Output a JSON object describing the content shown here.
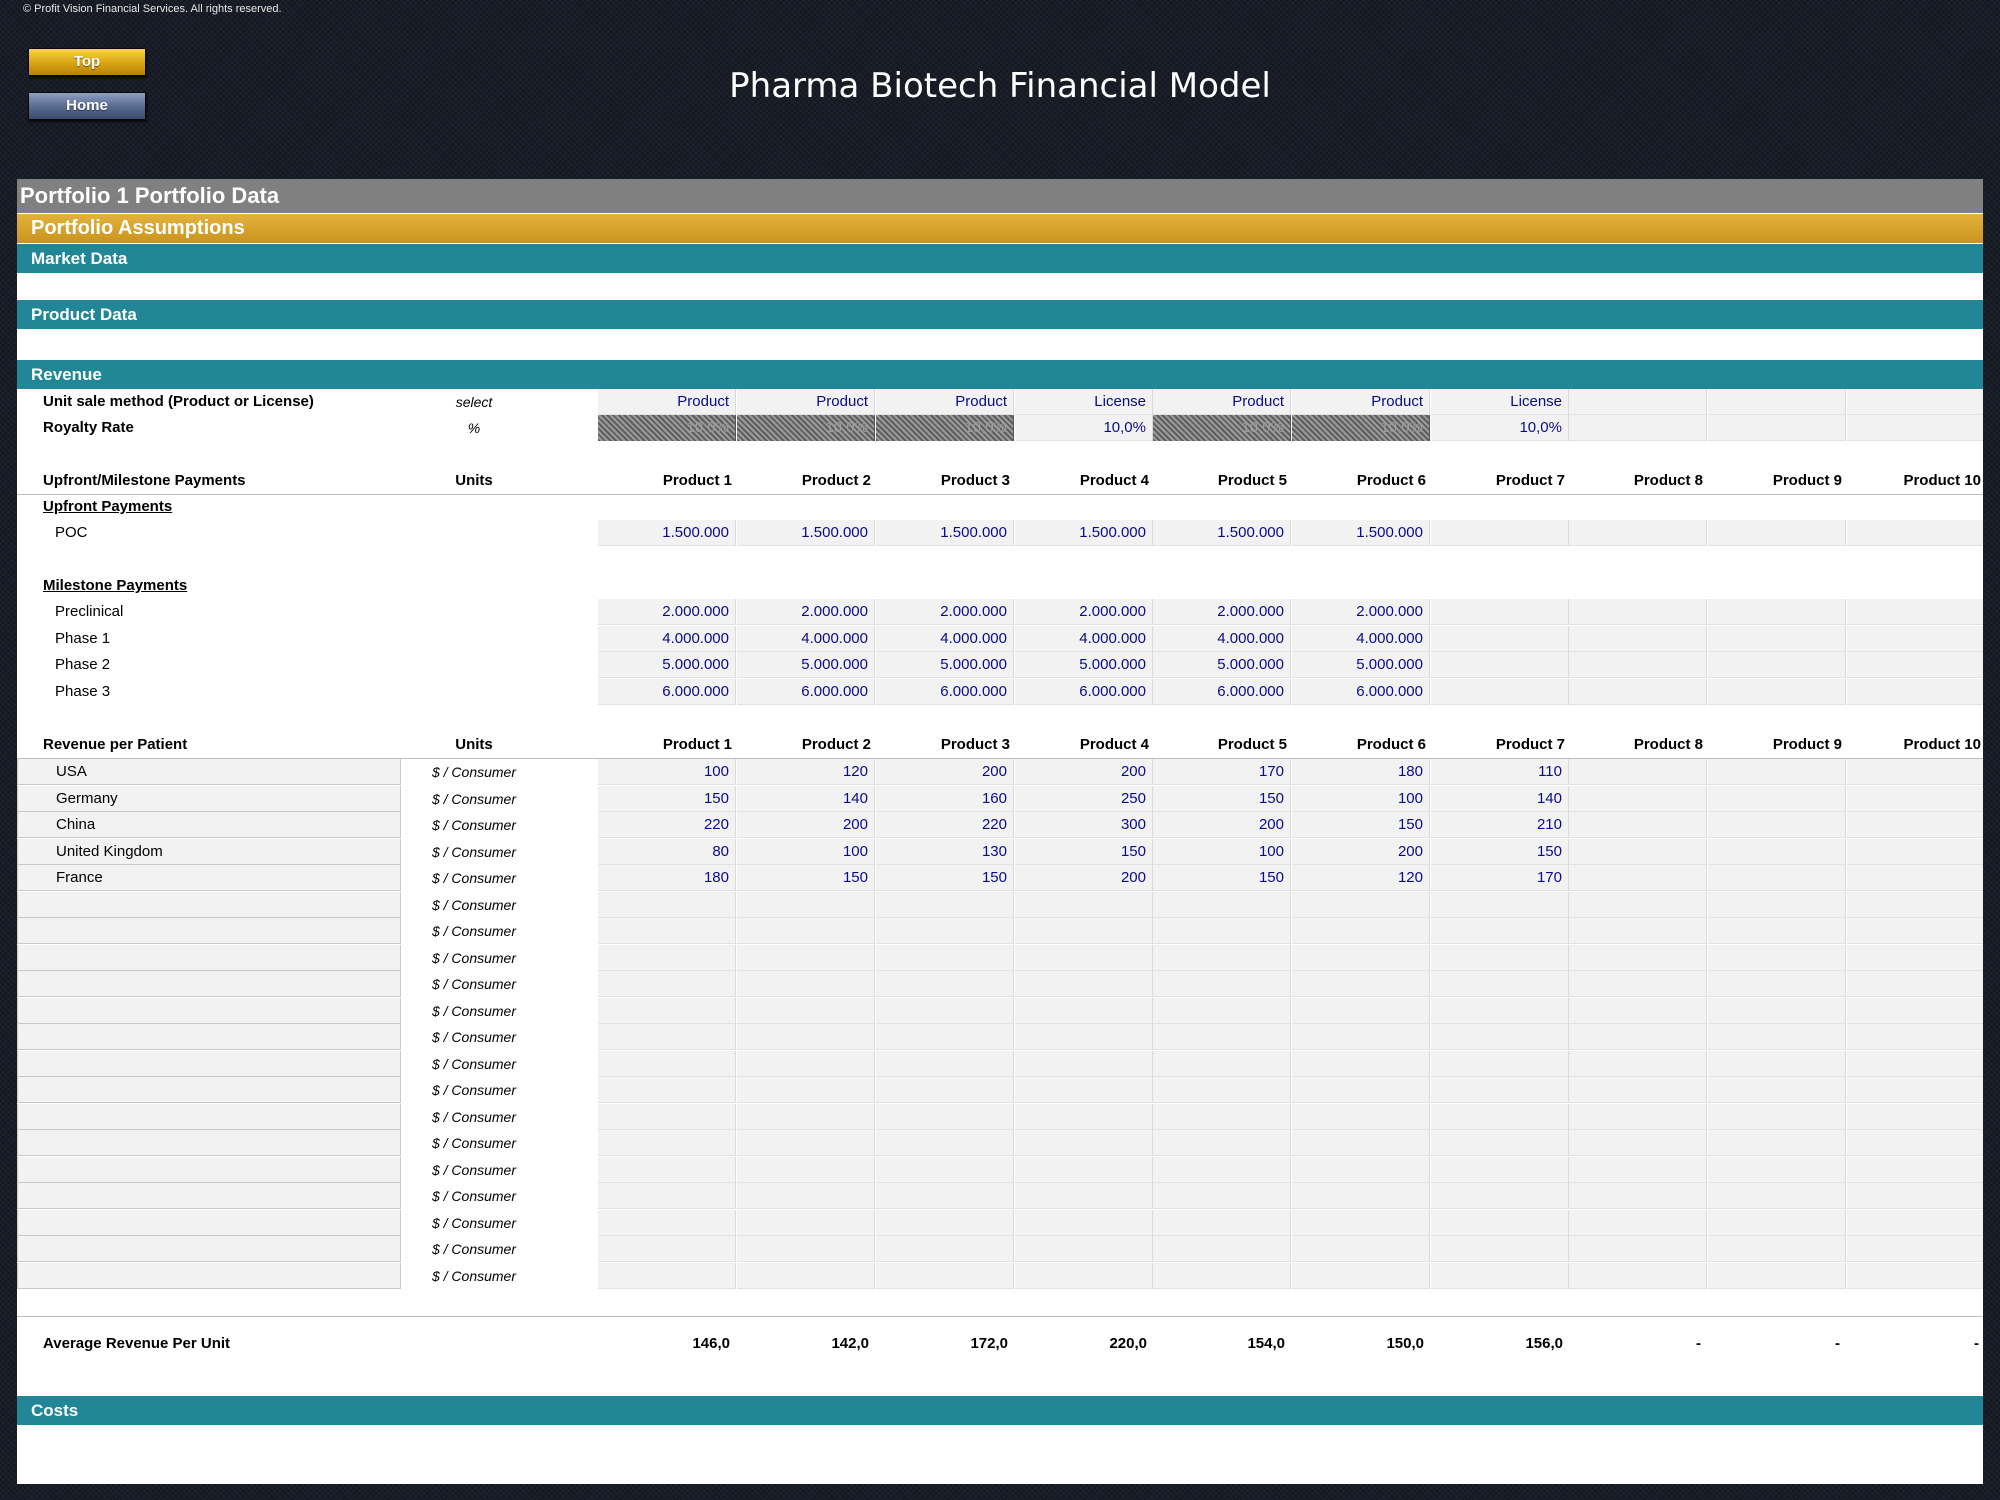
{
  "copyright": "© Profit Vision Financial Services. All rights reserved.",
  "nav": {
    "top_label": "Top",
    "home_label": "Home"
  },
  "title": "Pharma Biotech Financial Model",
  "sections": {
    "portfolio": "Portfolio 1 Portfolio Data",
    "assumptions": "Portfolio Assumptions",
    "market": "Market Data",
    "product": "Product Data",
    "revenue": "Revenue",
    "costs": "Costs"
  },
  "products": [
    "Product 1",
    "Product 2",
    "Product 3",
    "Product 4",
    "Product 5",
    "Product 6",
    "Product 7",
    "Product 8",
    "Product 9",
    "Product 10"
  ],
  "unit_sale": {
    "label": "Unit sale method (Product or License)",
    "unit": "select",
    "values": [
      "Product",
      "Product",
      "Product",
      "License",
      "Product",
      "Product",
      "License",
      "",
      "",
      ""
    ]
  },
  "royalty": {
    "label": "Royalty Rate",
    "unit": "%",
    "values": [
      "10,0%",
      "10,0%",
      "10,0%",
      "10,0%",
      "10,0%",
      "10,0%",
      "10,0%",
      "",
      "",
      ""
    ]
  },
  "upfront": {
    "header": "Upfront/Milestone Payments",
    "units_header": "Units",
    "upfront_label": "Upfront Payments",
    "rows": [
      {
        "label": "POC",
        "values": [
          "1.500.000",
          "1.500.000",
          "1.500.000",
          "1.500.000",
          "1.500.000",
          "1.500.000",
          "",
          "",
          "",
          ""
        ]
      }
    ],
    "milestone_label": "Milestone Payments",
    "milestones": [
      {
        "label": "Preclinical",
        "values": [
          "2.000.000",
          "2.000.000",
          "2.000.000",
          "2.000.000",
          "2.000.000",
          "2.000.000",
          "",
          "",
          "",
          ""
        ]
      },
      {
        "label": "Phase 1",
        "values": [
          "4.000.000",
          "4.000.000",
          "4.000.000",
          "4.000.000",
          "4.000.000",
          "4.000.000",
          "",
          "",
          "",
          ""
        ]
      },
      {
        "label": "Phase 2",
        "values": [
          "5.000.000",
          "5.000.000",
          "5.000.000",
          "5.000.000",
          "5.000.000",
          "5.000.000",
          "",
          "",
          "",
          ""
        ]
      },
      {
        "label": "Phase 3",
        "values": [
          "6.000.000",
          "6.000.000",
          "6.000.000",
          "6.000.000",
          "6.000.000",
          "6.000.000",
          "",
          "",
          "",
          ""
        ]
      }
    ]
  },
  "revenue_per_patient": {
    "header": "Revenue per Patient",
    "units_header": "Units",
    "unit": "$  / Consumer",
    "rows": [
      {
        "country": "USA",
        "values": [
          "100",
          "120",
          "200",
          "200",
          "170",
          "180",
          "110",
          "",
          "",
          ""
        ]
      },
      {
        "country": "Germany",
        "values": [
          "150",
          "140",
          "160",
          "250",
          "150",
          "100",
          "140",
          "",
          "",
          ""
        ]
      },
      {
        "country": "China",
        "values": [
          "220",
          "200",
          "220",
          "300",
          "200",
          "150",
          "210",
          "",
          "",
          ""
        ]
      },
      {
        "country": "United Kingdom",
        "values": [
          "80",
          "100",
          "130",
          "150",
          "100",
          "200",
          "150",
          "",
          "",
          ""
        ]
      },
      {
        "country": "France",
        "values": [
          "180",
          "150",
          "150",
          "200",
          "150",
          "120",
          "170",
          "",
          "",
          ""
        ]
      },
      {
        "country": "",
        "values": [
          "",
          "",
          "",
          "",
          "",
          "",
          "",
          "",
          "",
          ""
        ]
      },
      {
        "country": "",
        "values": [
          "",
          "",
          "",
          "",
          "",
          "",
          "",
          "",
          "",
          ""
        ]
      },
      {
        "country": "",
        "values": [
          "",
          "",
          "",
          "",
          "",
          "",
          "",
          "",
          "",
          ""
        ]
      },
      {
        "country": "",
        "values": [
          "",
          "",
          "",
          "",
          "",
          "",
          "",
          "",
          "",
          ""
        ]
      },
      {
        "country": "",
        "values": [
          "",
          "",
          "",
          "",
          "",
          "",
          "",
          "",
          "",
          ""
        ]
      },
      {
        "country": "",
        "values": [
          "",
          "",
          "",
          "",
          "",
          "",
          "",
          "",
          "",
          ""
        ]
      },
      {
        "country": "",
        "values": [
          "",
          "",
          "",
          "",
          "",
          "",
          "",
          "",
          "",
          ""
        ]
      },
      {
        "country": "",
        "values": [
          "",
          "",
          "",
          "",
          "",
          "",
          "",
          "",
          "",
          ""
        ]
      },
      {
        "country": "",
        "values": [
          "",
          "",
          "",
          "",
          "",
          "",
          "",
          "",
          "",
          ""
        ]
      },
      {
        "country": "",
        "values": [
          "",
          "",
          "",
          "",
          "",
          "",
          "",
          "",
          "",
          ""
        ]
      },
      {
        "country": "",
        "values": [
          "",
          "",
          "",
          "",
          "",
          "",
          "",
          "",
          "",
          ""
        ]
      },
      {
        "country": "",
        "values": [
          "",
          "",
          "",
          "",
          "",
          "",
          "",
          "",
          "",
          ""
        ]
      },
      {
        "country": "",
        "values": [
          "",
          "",
          "",
          "",
          "",
          "",
          "",
          "",
          "",
          ""
        ]
      },
      {
        "country": "",
        "values": [
          "",
          "",
          "",
          "",
          "",
          "",
          "",
          "",
          "",
          ""
        ]
      },
      {
        "country": "",
        "values": [
          "",
          "",
          "",
          "",
          "",
          "",
          "",
          "",
          "",
          ""
        ]
      }
    ]
  },
  "average": {
    "label": "Average Revenue Per Unit",
    "values": [
      "146,0",
      "142,0",
      "172,0",
      "220,0",
      "154,0",
      "150,0",
      "156,0",
      "-",
      "-",
      "-"
    ]
  }
}
